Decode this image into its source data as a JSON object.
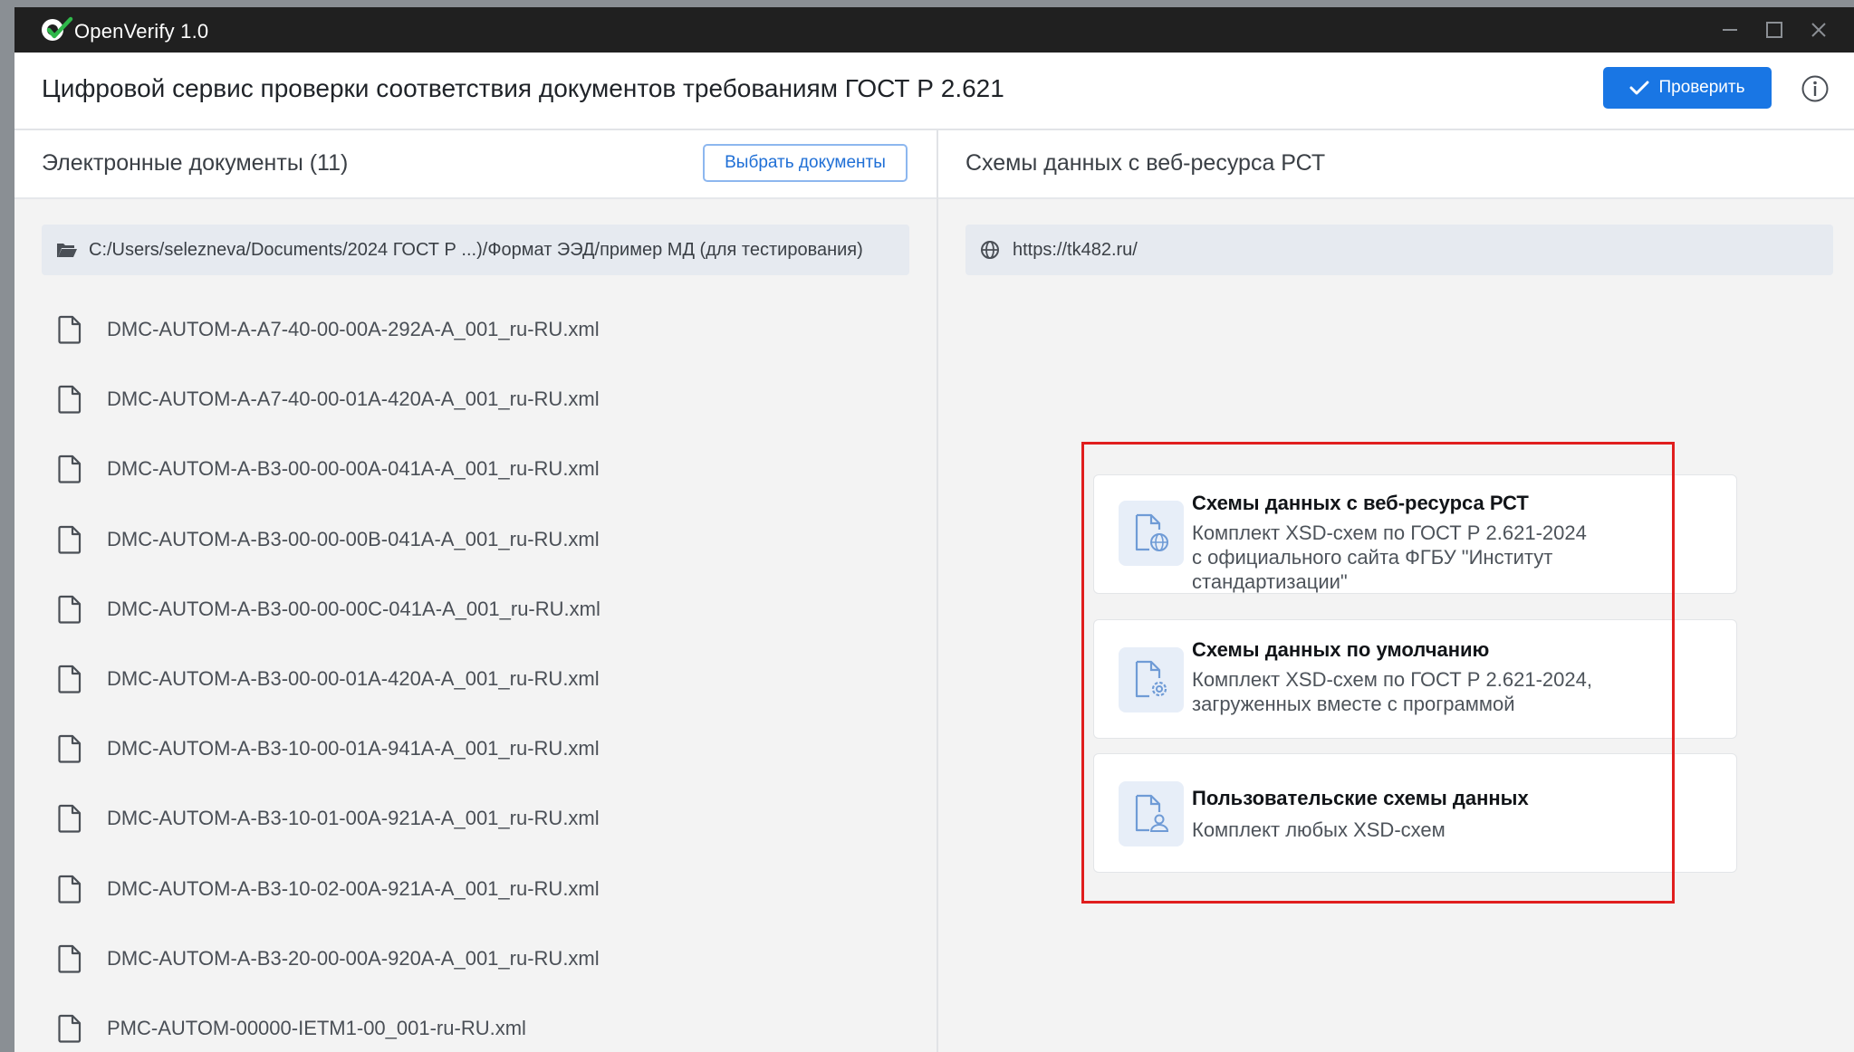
{
  "app": {
    "title": "OpenVerify 1.0"
  },
  "header": {
    "title": "Цифровой сервис проверки соответствия документов требованиям ГОСТ Р 2.621",
    "check_label": "Проверить"
  },
  "left": {
    "title": "Электронные документы (11)",
    "select_label": "Выбрать документы",
    "path": "C:/Users/selezneva/Documents/2024 ГОСТ Р ...)/Формат ЭЭД/пример МД (для тестирования)",
    "files": [
      "DMC-AUTOM-A-A7-40-00-00A-292A-A_001_ru-RU.xml",
      "DMC-AUTOM-A-A7-40-00-01A-420A-A_001_ru-RU.xml",
      "DMC-AUTOM-A-B3-00-00-00A-041A-A_001_ru-RU.xml",
      "DMC-AUTOM-A-B3-00-00-00B-041A-A_001_ru-RU.xml",
      "DMC-AUTOM-A-B3-00-00-00C-041A-A_001_ru-RU.xml",
      "DMC-AUTOM-A-B3-00-00-01A-420A-A_001_ru-RU.xml",
      "DMC-AUTOM-A-B3-10-00-01A-941A-A_001_ru-RU.xml",
      "DMC-AUTOM-A-B3-10-01-00A-921A-A_001_ru-RU.xml",
      "DMC-AUTOM-A-B3-10-02-00A-921A-A_001_ru-RU.xml",
      "DMC-AUTOM-A-B3-20-00-00A-920A-A_001_ru-RU.xml",
      "PMC-AUTOM-00000-IETM1-00_001-ru-RU.xml"
    ]
  },
  "right": {
    "title": "Схемы данных с веб-ресурса РСТ",
    "url": "https://tk482.ru/",
    "options": [
      {
        "title": "Схемы данных с веб-ресурса РСТ",
        "desc_lines": [
          "Комплект XSD-схем по ГОСТ Р 2.621-2024",
          "с официального сайта ФГБУ \"Институт",
          "стандартизации\""
        ],
        "icon": "file-globe-icon"
      },
      {
        "title": "Схемы данных по умолчанию",
        "desc_lines": [
          "Комплект XSD-схем по ГОСТ Р 2.621-2024,",
          "загруженных вместе с программой"
        ],
        "icon": "file-gear-icon"
      },
      {
        "title": "Пользовательские схемы данных",
        "desc_lines": [
          "Комплект любых XSD-схем"
        ],
        "icon": "file-user-icon"
      }
    ]
  },
  "colors": {
    "accent": "#1976e4",
    "titlebar": "#202020",
    "highlight": "#e01e1e"
  }
}
